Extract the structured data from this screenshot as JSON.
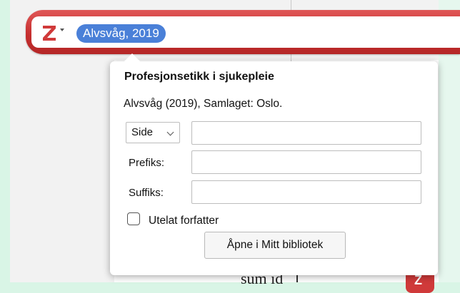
{
  "search_bar": {
    "logo_letter": "Z",
    "citation_bubble": "Alvsvåg, 2019"
  },
  "popup": {
    "title": "Profesjonsetikk i sjukepleie",
    "citation": "Alvsvåg (2019), Samlaget: Oslo.",
    "locator": {
      "selected": "Side",
      "value": ""
    },
    "prefix": {
      "label": "Prefiks:",
      "value": ""
    },
    "suffix": {
      "label": "Suffiks:",
      "value": ""
    },
    "omit_author": {
      "label": "Utelat forfatter",
      "checked": false
    },
    "open_button": "Åpne i Mitt bibliotek"
  },
  "document": {
    "partial_text": "sum id"
  },
  "colors": {
    "zotero_red": "#c62f2f",
    "bubble_blue": "#4a80d8",
    "background_green": "#d9f5e6"
  }
}
